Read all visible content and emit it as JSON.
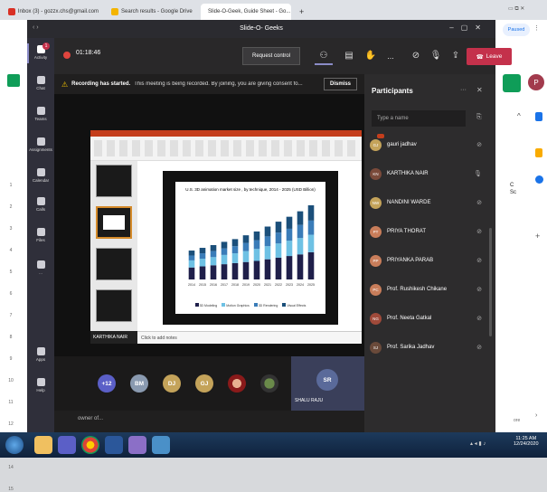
{
  "browser": {
    "tabs": [
      "Inbox (3) - gozzx.chs@gmail.com",
      "Search results - Google Drive",
      "Slide-O-Geek, Guide Sheet - Go..."
    ],
    "new_tab": "+",
    "profile_label": "Paused",
    "profile_initial": "P",
    "sheet_col_c": "C",
    "sheet_col_sub": "Sc",
    "row_numbers": [
      "1",
      "2",
      "3",
      "4",
      "5",
      "6",
      "7",
      "8",
      "9",
      "10",
      "11",
      "12",
      "13",
      "14",
      "15"
    ],
    "page_label": "ore"
  },
  "teams": {
    "window_title": "Slide-O- Geeks",
    "timer": "01:18:46",
    "request_control": "Request control",
    "more": "...",
    "leave": "Leave",
    "recording_banner": "Recording has started.",
    "recording_detail": "This meeting is being recorded. By joining, you are giving consent fo...",
    "dismiss": "Dismiss",
    "rail": [
      {
        "label": "Activity",
        "icon": "bell-icon",
        "badge": "1"
      },
      {
        "label": "Chat",
        "icon": "chat-icon"
      },
      {
        "label": "Teams",
        "icon": "teams-icon"
      },
      {
        "label": "Assignments",
        "icon": "assignments-icon"
      },
      {
        "label": "Calendar",
        "icon": "calendar-icon"
      },
      {
        "label": "Calls",
        "icon": "phone-icon"
      },
      {
        "label": "Files",
        "icon": "files-icon"
      },
      {
        "label": "...",
        "icon": "more-icon"
      },
      {
        "label": "Apps",
        "icon": "apps-icon"
      },
      {
        "label": "Help",
        "icon": "help-icon"
      }
    ],
    "presenter_name": "KARTHIKA NAIR",
    "gallery": [
      {
        "label": "+12",
        "color": "#5b5fc7"
      },
      {
        "label": "BM",
        "color": "#8a9ab0"
      },
      {
        "label": "DJ",
        "color": "#c4a35a"
      },
      {
        "label": "GJ",
        "color": "#c4a35a"
      }
    ],
    "spotlight": {
      "initials": "SR",
      "name": "SHALU RAJU"
    },
    "chat_preview": "owner of...",
    "participants_title": "Participants",
    "search_placeholder": "Type a name",
    "participants": [
      {
        "name": "gauri jadhav",
        "initials": "GJ",
        "color": "#c4a35a"
      },
      {
        "name": "KARTHIKA NAIR",
        "initials": "KN",
        "color": "#7a4a3a"
      },
      {
        "name": "NANDINI WARDE",
        "initials": "NW",
        "color": "#c4a35a"
      },
      {
        "name": "PRIYA THORAT",
        "initials": "PT",
        "color": "#c87d5a"
      },
      {
        "name": "PRIYANKA PARAB",
        "initials": "PP",
        "color": "#c87d5a"
      },
      {
        "name": "Prof. Rushikesh Chikane",
        "initials": "PC",
        "color": "#c87d5a"
      },
      {
        "name": "Prof. Neeta Gatkal",
        "initials": "NG",
        "color": "#a04a3a"
      },
      {
        "name": "Prof. Sarika Jadhav",
        "initials": "SJ",
        "color": "#6a4a3a"
      }
    ]
  },
  "slide": {
    "chart_title": "U.S. 3D animation market size , by technique, 2014 - 2025 (USD Billion)",
    "notes": "Click to add notes",
    "legend": [
      "3D Modeling",
      "Motion Graphics",
      "3D Rendering",
      "Visual Effects"
    ]
  },
  "chart_data": {
    "type": "bar",
    "title": "U.S. 3D animation market size , by technique, 2014 - 2025 (USD Billion)",
    "categories": [
      "2014",
      "2015",
      "2016",
      "2017",
      "2018",
      "2019",
      "2020",
      "2021",
      "2022",
      "2023",
      "2024",
      "2025"
    ],
    "series": [
      {
        "name": "3D Modeling",
        "values": [
          2.2,
          2.4,
          2.6,
          2.8,
          3.0,
          3.2,
          3.4,
          3.7,
          4.0,
          4.3,
          4.6,
          5.0
        ],
        "color": "#1f1f4a"
      },
      {
        "name": "Motion Graphics",
        "values": [
          1.3,
          1.4,
          1.5,
          1.7,
          1.8,
          2.0,
          2.2,
          2.4,
          2.6,
          2.8,
          3.0,
          3.2
        ],
        "color": "#6ec1e4"
      },
      {
        "name": "3D Rendering",
        "values": [
          0.9,
          1.0,
          1.1,
          1.2,
          1.3,
          1.5,
          1.6,
          1.8,
          2.0,
          2.2,
          2.4,
          2.6
        ],
        "color": "#3a7cb8"
      },
      {
        "name": "Visual Effects",
        "values": [
          0.9,
          1.0,
          1.1,
          1.2,
          1.3,
          1.4,
          1.6,
          1.8,
          2.0,
          2.2,
          2.5,
          2.8
        ],
        "color": "#1b4f7a"
      }
    ]
  },
  "taskbar": {
    "time": "11:25 AM",
    "date": "12/24/2020"
  }
}
